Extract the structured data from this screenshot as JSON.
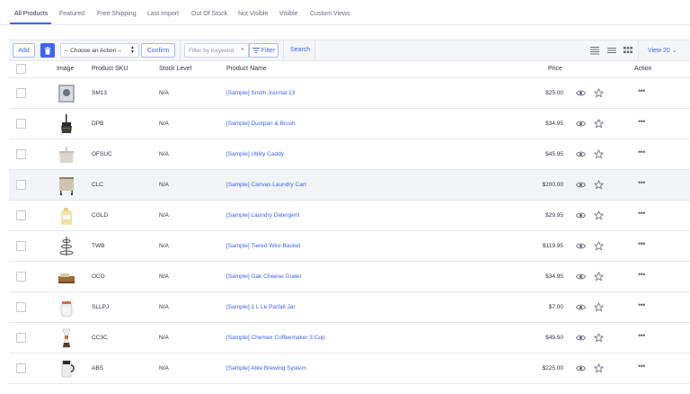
{
  "tabs": [
    {
      "label": "All Products",
      "active": true
    },
    {
      "label": "Featured"
    },
    {
      "label": "Free Shipping"
    },
    {
      "label": "Last Import"
    },
    {
      "label": "Out Of Stock"
    },
    {
      "label": "Not Visible"
    },
    {
      "label": "Visible"
    },
    {
      "label": "Custom Views"
    }
  ],
  "toolbar": {
    "add_label": "Add",
    "action_select_value": "-- Choose an Action --",
    "confirm_label": "Confirm",
    "filter_placeholder": "Filter by Keyword",
    "filter_label": "Filter",
    "search_label": "Search",
    "view_count_label": "View 20"
  },
  "table": {
    "headers": {
      "image": "Image",
      "sku": "Product SKU",
      "stock": "Stock Level",
      "name": "Product Name",
      "price": "Price",
      "action": "Action"
    },
    "rows": [
      {
        "sku": "SM13",
        "stock": "N/A",
        "name": "[Sample] Smith Journal 13",
        "price": "$25.00",
        "thumb": "journal"
      },
      {
        "sku": "DPB",
        "stock": "N/A",
        "name": "[Sample] Dustpan & Brush",
        "price": "$34.95",
        "thumb": "dustpan"
      },
      {
        "sku": "OFSUC",
        "stock": "N/A",
        "name": "[Sample] Utility Caddy",
        "price": "$45.95",
        "thumb": "caddy"
      },
      {
        "sku": "CLC",
        "stock": "N/A",
        "name": "[Sample] Canvas Laundry Cart",
        "price": "$200.00",
        "thumb": "cart",
        "highlighted": true
      },
      {
        "sku": "CGLD",
        "stock": "N/A",
        "name": "[Sample] Laundry Detergent",
        "price": "$29.95",
        "thumb": "detergent"
      },
      {
        "sku": "TWB",
        "stock": "N/A",
        "name": "[Sample] Tiered Wire Basket",
        "price": "$119.95",
        "thumb": "basket"
      },
      {
        "sku": "OCG",
        "stock": "N/A",
        "name": "[Sample] Oak Cheese Grater",
        "price": "$34.95",
        "thumb": "grater"
      },
      {
        "sku": "SLLPJ",
        "stock": "N/A",
        "name": "[Sample] 1 L Le Parfait Jar",
        "price": "$7.00",
        "thumb": "jar"
      },
      {
        "sku": "CC3C",
        "stock": "N/A",
        "name": "[Sample] Chemex Coffeemaker 3 Cup",
        "price": "$49.50",
        "thumb": "chemex"
      },
      {
        "sku": "ABS",
        "stock": "N/A",
        "name": "[Sample] Able Brewing System",
        "price": "$225.00",
        "thumb": "brewer"
      }
    ]
  },
  "colors": {
    "accent": "#3c64f4",
    "text": "#313440",
    "muted": "#6b6f7d",
    "border": "#e6e8ee"
  }
}
